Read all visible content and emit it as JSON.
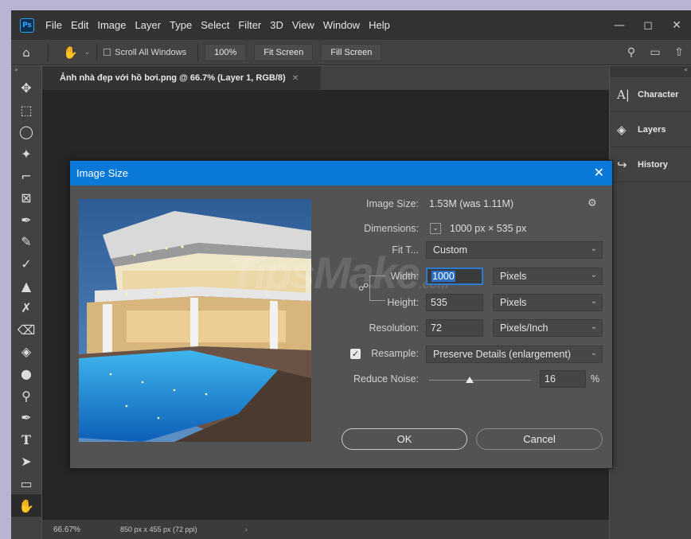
{
  "menubar": {
    "logo": "Ps",
    "items": [
      "File",
      "Edit",
      "Image",
      "Layer",
      "Type",
      "Select",
      "Filter",
      "3D",
      "View",
      "Window",
      "Help"
    ]
  },
  "options": {
    "scroll_all_label": "Scroll All Windows",
    "zoom_btn": "100%",
    "fit_screen_btn": "Fit Screen",
    "fill_screen_btn": "Fill Screen"
  },
  "document": {
    "tab_title": "Ảnh nhà đẹp với hồ bơi.png @ 66.7% (Layer 1, RGB/8)",
    "status_zoom": "66.67%",
    "status_info": "850 px x 455 px (72 ppi)"
  },
  "panels": {
    "items": [
      {
        "label": "Character",
        "icon": "character-icon"
      },
      {
        "label": "Layers",
        "icon": "layers-icon"
      },
      {
        "label": "History",
        "icon": "history-icon"
      }
    ]
  },
  "dialog": {
    "title": "Image Size",
    "image_size_label": "Image Size:",
    "image_size_value": "1.53M (was 1.11M)",
    "dimensions_label": "Dimensions:",
    "dimensions_value": "1000 px  ×  535 px",
    "fit_label": "Fit T...",
    "fit_value": "Custom",
    "width_label": "Width:",
    "width_value": "1000",
    "width_unit": "Pixels",
    "height_label": "Height:",
    "height_value": "535",
    "height_unit": "Pixels",
    "resolution_label": "Resolution:",
    "resolution_value": "72",
    "resolution_unit": "Pixels/Inch",
    "resample_label": "Resample:",
    "resample_checked": true,
    "resample_value": "Preserve Details (enlargement)",
    "reduce_noise_label": "Reduce Noise:",
    "reduce_noise_value": "16",
    "reduce_noise_unit": "%",
    "ok_label": "OK",
    "cancel_label": "Cancel"
  },
  "watermark": {
    "brand": "TipsMake",
    "suffix": ".com"
  },
  "colors": {
    "accent": "#0a78d7",
    "app_bg": "#535353",
    "menubar_bg": "#323232"
  }
}
